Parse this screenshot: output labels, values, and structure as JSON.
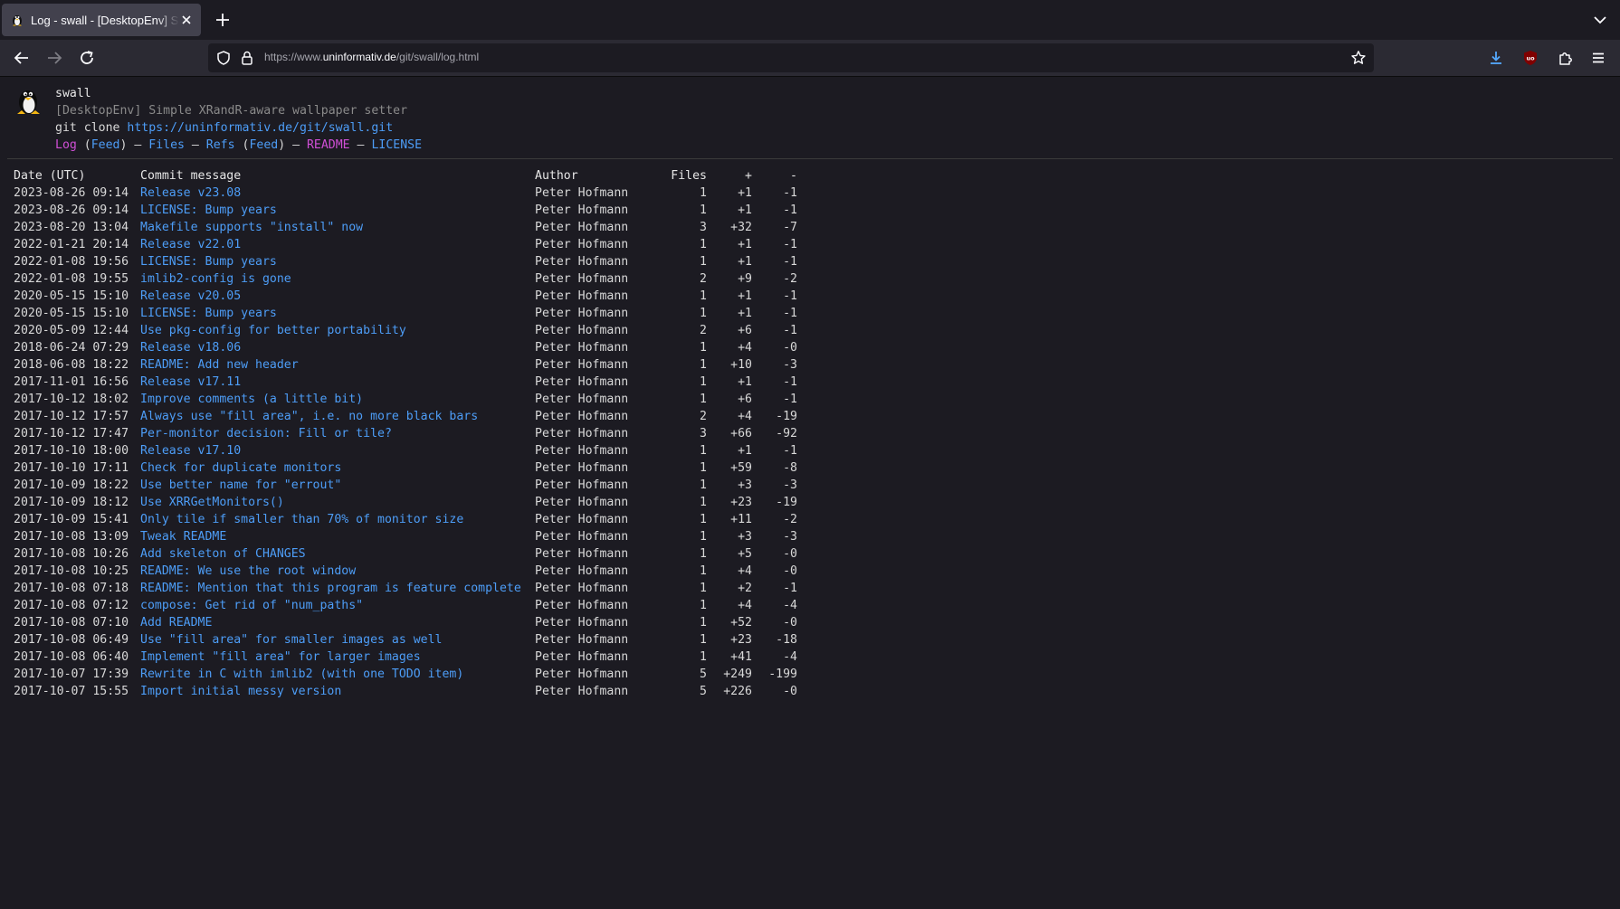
{
  "browser": {
    "tab_title": "Log - swall - [DesktopEnv] Simple XRandR-aware wallpaper setter",
    "url_prefix": "https://www.",
    "url_host": "uninformativ.de",
    "url_path": "/git/swall/log.html"
  },
  "repo": {
    "name": "swall",
    "description": "[DesktopEnv] Simple XRandR-aware wallpaper setter",
    "clone_prefix": "git clone",
    "clone_url": "https://uninformativ.de/git/swall.git"
  },
  "nav": {
    "log": "Log",
    "log_feed": "Feed",
    "files": "Files",
    "refs": "Refs",
    "refs_feed": "Feed",
    "readme": "README",
    "license": "LICENSE"
  },
  "table": {
    "headers": {
      "date": "Date (UTC)",
      "message": "Commit message",
      "author": "Author",
      "files": "Files",
      "added": "+",
      "removed": "-"
    },
    "rows": [
      {
        "date": "2023-08-26 09:14",
        "msg": "Release v23.08",
        "author": "Peter Hofmann",
        "files": "1",
        "add": "+1",
        "del": "-1"
      },
      {
        "date": "2023-08-26 09:14",
        "msg": "LICENSE: Bump years",
        "author": "Peter Hofmann",
        "files": "1",
        "add": "+1",
        "del": "-1"
      },
      {
        "date": "2023-08-20 13:04",
        "msg": "Makefile supports \"install\" now",
        "author": "Peter Hofmann",
        "files": "3",
        "add": "+32",
        "del": "-7"
      },
      {
        "date": "2022-01-21 20:14",
        "msg": "Release v22.01",
        "author": "Peter Hofmann",
        "files": "1",
        "add": "+1",
        "del": "-1"
      },
      {
        "date": "2022-01-08 19:56",
        "msg": "LICENSE: Bump years",
        "author": "Peter Hofmann",
        "files": "1",
        "add": "+1",
        "del": "-1"
      },
      {
        "date": "2022-01-08 19:55",
        "msg": "imlib2-config is gone",
        "author": "Peter Hofmann",
        "files": "2",
        "add": "+9",
        "del": "-2"
      },
      {
        "date": "2020-05-15 15:10",
        "msg": "Release v20.05",
        "author": "Peter Hofmann",
        "files": "1",
        "add": "+1",
        "del": "-1"
      },
      {
        "date": "2020-05-15 15:10",
        "msg": "LICENSE: Bump years",
        "author": "Peter Hofmann",
        "files": "1",
        "add": "+1",
        "del": "-1"
      },
      {
        "date": "2020-05-09 12:44",
        "msg": "Use pkg-config for better portability",
        "author": "Peter Hofmann",
        "files": "2",
        "add": "+6",
        "del": "-1"
      },
      {
        "date": "2018-06-24 07:29",
        "msg": "Release v18.06",
        "author": "Peter Hofmann",
        "files": "1",
        "add": "+4",
        "del": "-0"
      },
      {
        "date": "2018-06-08 18:22",
        "msg": "README: Add new header",
        "author": "Peter Hofmann",
        "files": "1",
        "add": "+10",
        "del": "-3"
      },
      {
        "date": "2017-11-01 16:56",
        "msg": "Release v17.11",
        "author": "Peter Hofmann",
        "files": "1",
        "add": "+1",
        "del": "-1"
      },
      {
        "date": "2017-10-12 18:02",
        "msg": "Improve comments (a little bit)",
        "author": "Peter Hofmann",
        "files": "1",
        "add": "+6",
        "del": "-1"
      },
      {
        "date": "2017-10-12 17:57",
        "msg": "Always use \"fill area\", i.e. no more black bars",
        "author": "Peter Hofmann",
        "files": "2",
        "add": "+4",
        "del": "-19"
      },
      {
        "date": "2017-10-12 17:47",
        "msg": "Per-monitor decision: Fill or tile?",
        "author": "Peter Hofmann",
        "files": "3",
        "add": "+66",
        "del": "-92"
      },
      {
        "date": "2017-10-10 18:00",
        "msg": "Release v17.10",
        "author": "Peter Hofmann",
        "files": "1",
        "add": "+1",
        "del": "-1"
      },
      {
        "date": "2017-10-10 17:11",
        "msg": "Check for duplicate monitors",
        "author": "Peter Hofmann",
        "files": "1",
        "add": "+59",
        "del": "-8"
      },
      {
        "date": "2017-10-09 18:22",
        "msg": "Use better name for \"errout\"",
        "author": "Peter Hofmann",
        "files": "1",
        "add": "+3",
        "del": "-3"
      },
      {
        "date": "2017-10-09 18:12",
        "msg": "Use XRRGetMonitors()",
        "author": "Peter Hofmann",
        "files": "1",
        "add": "+23",
        "del": "-19"
      },
      {
        "date": "2017-10-09 15:41",
        "msg": "Only tile if smaller than 70% of monitor size",
        "author": "Peter Hofmann",
        "files": "1",
        "add": "+11",
        "del": "-2"
      },
      {
        "date": "2017-10-08 13:09",
        "msg": "Tweak README",
        "author": "Peter Hofmann",
        "files": "1",
        "add": "+3",
        "del": "-3"
      },
      {
        "date": "2017-10-08 10:26",
        "msg": "Add skeleton of CHANGES",
        "author": "Peter Hofmann",
        "files": "1",
        "add": "+5",
        "del": "-0"
      },
      {
        "date": "2017-10-08 10:25",
        "msg": "README: We use the root window",
        "author": "Peter Hofmann",
        "files": "1",
        "add": "+4",
        "del": "-0"
      },
      {
        "date": "2017-10-08 07:18",
        "msg": "README: Mention that this program is feature complete",
        "author": "Peter Hofmann",
        "files": "1",
        "add": "+2",
        "del": "-1"
      },
      {
        "date": "2017-10-08 07:12",
        "msg": "compose: Get rid of \"num_paths\"",
        "author": "Peter Hofmann",
        "files": "1",
        "add": "+4",
        "del": "-4"
      },
      {
        "date": "2017-10-08 07:10",
        "msg": "Add README",
        "author": "Peter Hofmann",
        "files": "1",
        "add": "+52",
        "del": "-0"
      },
      {
        "date": "2017-10-08 06:49",
        "msg": "Use \"fill area\" for smaller images as well",
        "author": "Peter Hofmann",
        "files": "1",
        "add": "+23",
        "del": "-18"
      },
      {
        "date": "2017-10-08 06:40",
        "msg": "Implement \"fill area\" for larger images",
        "author": "Peter Hofmann",
        "files": "1",
        "add": "+41",
        "del": "-4"
      },
      {
        "date": "2017-10-07 17:39",
        "msg": "Rewrite in C with imlib2 (with one TODO item)",
        "author": "Peter Hofmann",
        "files": "5",
        "add": "+249",
        "del": "-199"
      },
      {
        "date": "2017-10-07 15:55",
        "msg": "Import initial messy version",
        "author": "Peter Hofmann",
        "files": "5",
        "add": "+226",
        "del": "-0"
      }
    ]
  },
  "colors": {
    "link": "#4d9df7",
    "active_link": "#d04fd6",
    "background": "#1c1b22",
    "toolbar": "#2b2a33"
  },
  "icons": {
    "favicon": "penguin-icon",
    "tab_close": "close-icon",
    "new_tab": "plus-icon",
    "tab_list": "chevron-down-icon",
    "back": "arrow-left-icon",
    "forward": "arrow-right-icon",
    "reload": "reload-icon",
    "shield": "shield-icon",
    "lock": "lock-icon",
    "bookmark": "star-icon",
    "downloads": "download-icon",
    "ublock": "ublock-icon",
    "extensions": "puzzle-icon",
    "menu": "hamburger-menu-icon"
  }
}
